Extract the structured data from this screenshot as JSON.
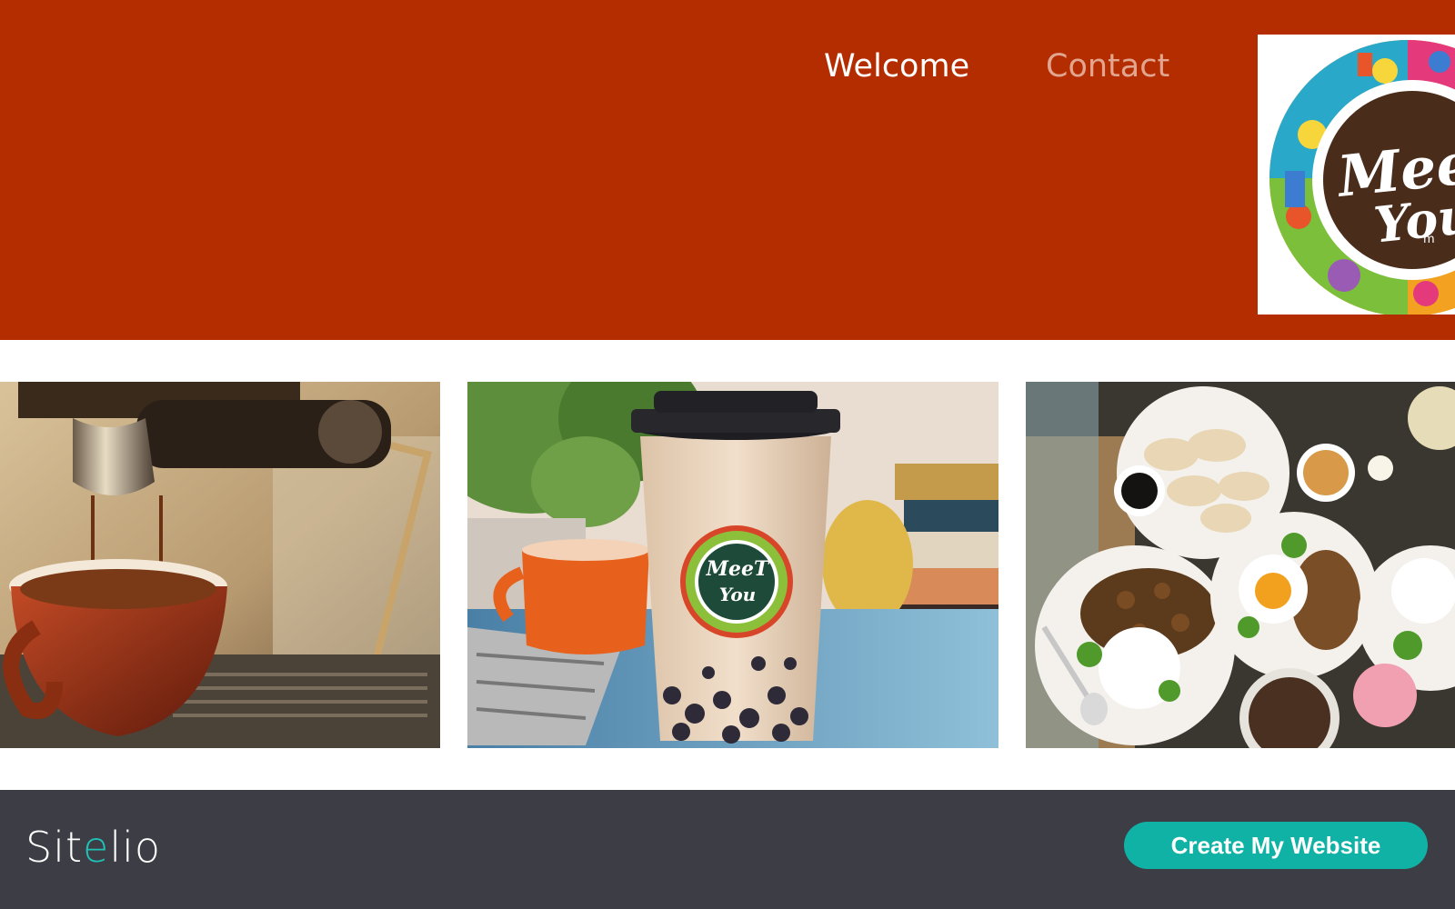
{
  "nav": {
    "items": [
      {
        "label": "Welcome",
        "active": true
      },
      {
        "label": "Contact",
        "active": false
      }
    ]
  },
  "logo": {
    "line1": "MeeT",
    "line2": "You",
    "mark": "m"
  },
  "gallery": {
    "cup_logo_line1": "MeeT",
    "cup_logo_line2": "You"
  },
  "footer": {
    "brand_before": "Sit",
    "brand_accent": "e",
    "brand_after": "lio",
    "cta_label": "Create My Website"
  },
  "colors": {
    "header_bg": "#b42d00",
    "footer_bg": "#3d3d46",
    "cta_bg": "#10b2a6",
    "brand_accent": "#1fc2b4"
  }
}
